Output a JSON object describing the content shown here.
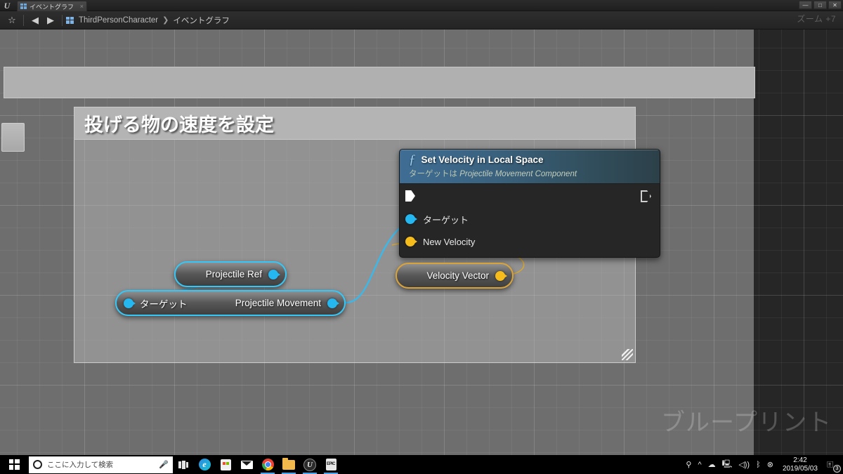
{
  "window": {
    "app_logo": "unreal-engine-logo",
    "tab_label": "イベントグラフ",
    "tab_close": "×",
    "minimize": "—",
    "maximize": "□",
    "close": "✕"
  },
  "toolbar": {
    "favorite_icon": "☆",
    "back_icon": "◀",
    "forward_icon": "▶",
    "breadcrumb_root": "ThirdPersonCharacter",
    "breadcrumb_sep": "❯",
    "breadcrumb_current": "イベントグラフ",
    "zoom_label": "ズーム +7"
  },
  "canvas": {
    "watermark": "ブループリント",
    "comment_title": "投げる物の速度を設定"
  },
  "function_node": {
    "icon": "function-f-icon",
    "title": "Set Velocity in Local Space",
    "subtitle_prefix": "ターゲットは ",
    "subtitle_target": "Projectile Movement Component",
    "exec_in": "exec-in-pin",
    "exec_out": "exec-out-pin",
    "pins": [
      {
        "label": "ターゲット",
        "color": "#24b7f0",
        "type": "object"
      },
      {
        "label": "New Velocity",
        "color": "#f5bc1b",
        "type": "vector"
      }
    ]
  },
  "nodes": [
    {
      "name": "projectile-ref",
      "label": "Projectile Ref",
      "pin_color": "#24b7f0"
    },
    {
      "name": "projectile-movement",
      "label_in": "ターゲット",
      "label_out": "Projectile Movement",
      "pin_color": "#24b7f0"
    },
    {
      "name": "velocity-vector",
      "label": "Velocity Vector",
      "pin_color": "#f5bc1b"
    }
  ],
  "colors": {
    "exec_white": "#ffffff",
    "object_blue": "#24b7f0",
    "vector_yellow": "#f5bc1b",
    "node_header_blue": "#3f6d94",
    "selection_cyan": "#35c7f7",
    "selection_gold": "#d9a33a"
  },
  "taskbar": {
    "start": "windows-start-icon",
    "search_placeholder": "ここに入力して検索",
    "cortana_icon": "cortana-circle-icon",
    "mic_icon": "🎤",
    "apps": [
      {
        "name": "task-view-icon",
        "glyph": ""
      },
      {
        "name": "edge-icon",
        "glyph": "e"
      },
      {
        "name": "microsoft-store-icon",
        "glyph": ""
      },
      {
        "name": "mail-icon",
        "glyph": ""
      },
      {
        "name": "chrome-icon",
        "glyph": ""
      },
      {
        "name": "file-explorer-icon",
        "glyph": ""
      },
      {
        "name": "unreal-engine-icon",
        "glyph": "U"
      },
      {
        "name": "epic-games-icon",
        "glyph": "EPIC"
      }
    ],
    "tray": [
      {
        "name": "pen-icon",
        "glyph": "⚲"
      },
      {
        "name": "show-hidden-icons-chevron",
        "glyph": "^"
      },
      {
        "name": "onedrive-icon",
        "glyph": "☁"
      },
      {
        "name": "network-icon",
        "glyph": "🖳"
      },
      {
        "name": "volume-icon",
        "glyph": "◁))"
      },
      {
        "name": "bluetooth-icon",
        "glyph": "ᛒ"
      },
      {
        "name": "power-icon",
        "glyph": "⊗"
      }
    ],
    "time": "2:42",
    "date": "2019/05/03",
    "notification_icon": "notification-center-icon",
    "notification_count": "3"
  }
}
